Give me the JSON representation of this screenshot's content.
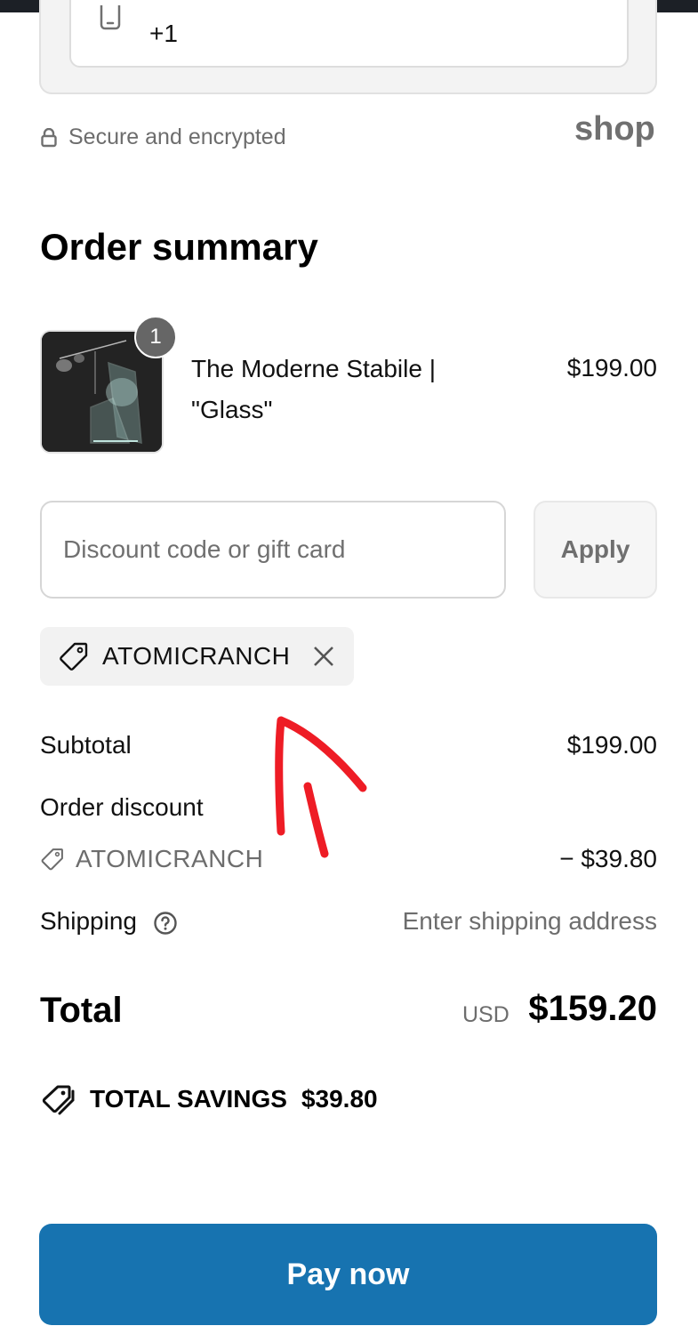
{
  "contact": {
    "phone_value": "+1"
  },
  "secure": {
    "text": "Secure and encrypted",
    "brand": "shop"
  },
  "order_summary": {
    "title": "Order summary",
    "item": {
      "quantity": "1",
      "name": "The Moderne Stabile | \"Glass\"",
      "price": "$199.00"
    },
    "discount_input": {
      "placeholder": "Discount code or gift card",
      "value": ""
    },
    "apply_label": "Apply",
    "applied_code": "ATOMICRANCH",
    "subtotal_label": "Subtotal",
    "subtotal_value": "$199.00",
    "order_discount_label": "Order discount",
    "discount_code": "ATOMICRANCH",
    "discount_value": "− $39.80",
    "shipping_label": "Shipping",
    "shipping_value": "Enter shipping address",
    "total_label": "Total",
    "total_currency": "USD",
    "total_value": "$159.20",
    "savings_label": "TOTAL SAVINGS",
    "savings_value": "$39.80"
  },
  "pay_button_label": "Pay now",
  "icons": {
    "phone": "phone-icon",
    "lock": "lock-icon",
    "tag": "tag-icon",
    "close": "close-icon",
    "help": "help-circle-icon",
    "savings": "double-tag-icon"
  },
  "colors": {
    "primary": "#1773b0",
    "annotation": "#ee1c25",
    "muted_text": "#6d6d6d"
  }
}
